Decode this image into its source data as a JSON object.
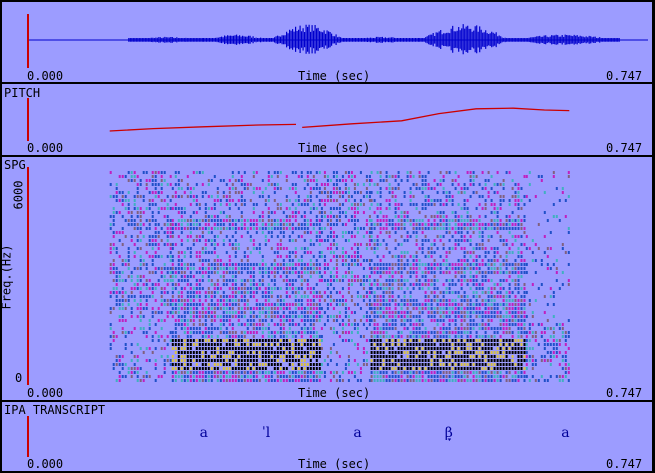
{
  "colors": {
    "background": "#9c9cff",
    "separator": "#000000",
    "cursor": "#cc0000",
    "waveform": "#0000cc",
    "pitch": "#cc0000",
    "ipa_text": "#000099",
    "spectrogram": [
      "#000000",
      "#d8c040",
      "#2050c8",
      "#40b0c0",
      "#c020c0",
      "#806080"
    ]
  },
  "waveform_panel": {
    "time_start": "0.000",
    "time_end": "0.747",
    "axis_label": "Time (sec)",
    "duration_sec": 0.747,
    "segments": [
      {
        "start": 0.12,
        "end": 0.21,
        "amplitude": 0.2
      },
      {
        "start": 0.21,
        "end": 0.29,
        "amplitude": 0.35
      },
      {
        "start": 0.29,
        "end": 0.38,
        "amplitude": 1.0
      },
      {
        "start": 0.38,
        "end": 0.47,
        "amplitude": 0.2
      },
      {
        "start": 0.47,
        "end": 0.58,
        "amplitude": 1.0
      },
      {
        "start": 0.58,
        "end": 0.71,
        "amplitude": 0.35
      }
    ]
  },
  "pitch_panel": {
    "title": "PITCH",
    "time_start": "0.000",
    "time_end": "0.747",
    "axis_label": "Time (sec)",
    "curve_segments": [
      [
        [
          0.13,
          0.1
        ],
        [
          0.2,
          0.18
        ],
        [
          0.28,
          0.24
        ],
        [
          0.37,
          0.3
        ],
        [
          0.43,
          0.32
        ]
      ],
      [
        [
          0.44,
          0.22
        ],
        [
          0.52,
          0.34
        ],
        [
          0.6,
          0.44
        ],
        [
          0.66,
          0.68
        ],
        [
          0.72,
          0.84
        ],
        [
          0.78,
          0.86
        ],
        [
          0.83,
          0.8
        ],
        [
          0.87,
          0.78
        ]
      ]
    ]
  },
  "spectrogram_panel": {
    "title": "SPG",
    "y_axis_label": "Freq.(Hz)",
    "y_max_label": "6000",
    "y_min_label": "0",
    "time_start": "0.000",
    "time_end": "0.747",
    "axis_label": "Time (sec)",
    "regions": [
      {
        "start": 0.13,
        "end": 0.23,
        "kind": "frication"
      },
      {
        "start": 0.23,
        "end": 0.47,
        "kind": "vowel"
      },
      {
        "start": 0.47,
        "end": 0.55,
        "kind": "frication"
      },
      {
        "start": 0.55,
        "end": 0.8,
        "kind": "vowel"
      },
      {
        "start": 0.8,
        "end": 0.87,
        "kind": "fade"
      }
    ]
  },
  "ipa_panel": {
    "title": "IPA TRANSCRIPT",
    "time_start": "0.000",
    "time_end": "0.747",
    "axis_label": "Time (sec)",
    "segments": [
      {
        "symbol": "a",
        "time": 0.21
      },
      {
        "symbol": "ˈl",
        "time": 0.285
      },
      {
        "symbol": "a",
        "time": 0.395
      },
      {
        "symbol": "β̞",
        "time": 0.505
      },
      {
        "symbol": "a",
        "time": 0.645
      }
    ]
  }
}
